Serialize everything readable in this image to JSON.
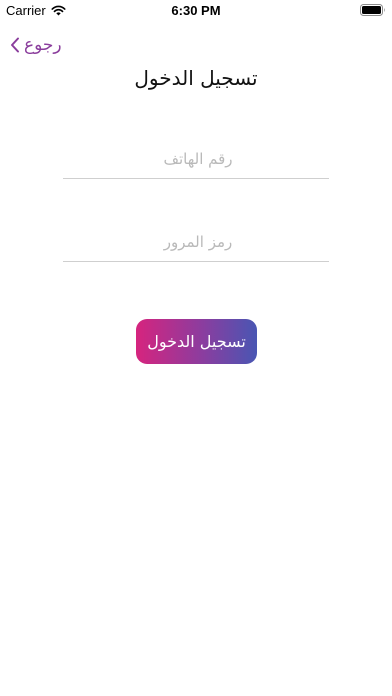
{
  "status_bar": {
    "carrier": "Carrier",
    "time": "6:30 PM"
  },
  "nav": {
    "back_label": "رجوع"
  },
  "page": {
    "title": "تسجيل الدخول"
  },
  "form": {
    "phone_placeholder": "رقم الهاتف",
    "password_placeholder": "رمز المرور",
    "login_label": "تسجيل الدخول"
  },
  "colors": {
    "accent": "#8a3d9c",
    "button_gradient_start": "#d6247e",
    "button_gradient_end": "#4956b3"
  },
  "icons": [
    "wifi-icon",
    "battery-icon",
    "chevron-left-icon"
  ]
}
